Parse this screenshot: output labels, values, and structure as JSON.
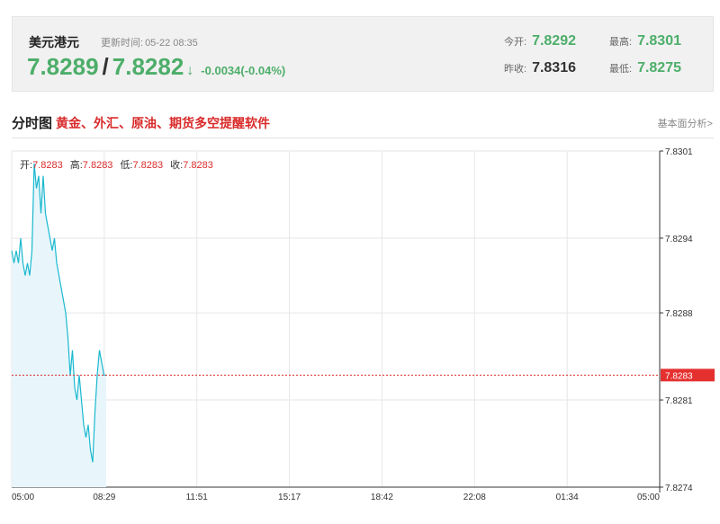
{
  "quote": {
    "name": "美元港元",
    "update_label": "更新时间:",
    "update_time": "05-22 08:35",
    "bid": "7.8289",
    "separator": "/",
    "ask": "7.8282",
    "arrow": "↓",
    "change": "-0.0034(-0.04%)",
    "stats": {
      "open_label": "今开:",
      "open": "7.8292",
      "high_label": "最高:",
      "high": "7.8301",
      "prev_label": "昨收:",
      "prev": "7.8316",
      "low_label": "最低:",
      "low": "7.8275"
    },
    "colors": {
      "up_green": "#4dae6a",
      "accent_red": "#d92a2a",
      "line": "#1ab8cf"
    }
  },
  "section": {
    "title": "分时图",
    "link": "黄金、外汇、原油、期货多空提醒软件",
    "right_link": "基本面分析>"
  },
  "ohlc": {
    "open_label": "开:",
    "open": "7.8283",
    "high_label": "高:",
    "high": "7.8283",
    "low_label": "低:",
    "low": "7.8283",
    "close_label": "收:",
    "close": "7.8283"
  },
  "chart_data": {
    "type": "line",
    "x_ticks": [
      "05:00",
      "08:29",
      "11:51",
      "15:17",
      "18:42",
      "22:08",
      "01:34",
      "05:00"
    ],
    "y_ticks": [
      "7.8301",
      "7.8294",
      "7.8288",
      "7.8281",
      "7.8274"
    ],
    "ylim": [
      7.8274,
      7.8301
    ],
    "current_price": "7.8283",
    "current_value": 7.8283,
    "grid": true,
    "x_minutes_start": 0,
    "x_minutes_end": 1440,
    "series": [
      {
        "x": [
          0,
          5,
          10,
          15,
          20,
          25,
          30,
          35,
          40,
          45,
          50,
          55,
          60,
          65,
          70,
          75,
          80,
          85,
          90,
          95,
          100,
          105,
          110,
          115,
          120,
          125,
          130,
          135,
          140,
          145,
          150,
          155,
          160,
          165,
          170,
          175,
          180,
          185,
          190,
          195,
          200,
          205,
          210
        ],
        "y": [
          7.8293,
          7.8292,
          7.8293,
          7.8292,
          7.8294,
          7.8292,
          7.8291,
          7.8292,
          7.8291,
          7.8293,
          7.83,
          7.8298,
          7.8299,
          7.8296,
          7.8299,
          7.8296,
          7.8295,
          7.8294,
          7.8293,
          7.8294,
          7.8292,
          7.8291,
          7.829,
          7.8289,
          7.8288,
          7.8286,
          7.8283,
          7.8285,
          7.8282,
          7.8281,
          7.8283,
          7.8281,
          7.8279,
          7.8278,
          7.8279,
          7.8277,
          7.8276,
          7.828,
          7.8283,
          7.8285,
          7.8284,
          7.8283,
          7.8283
        ]
      }
    ]
  }
}
